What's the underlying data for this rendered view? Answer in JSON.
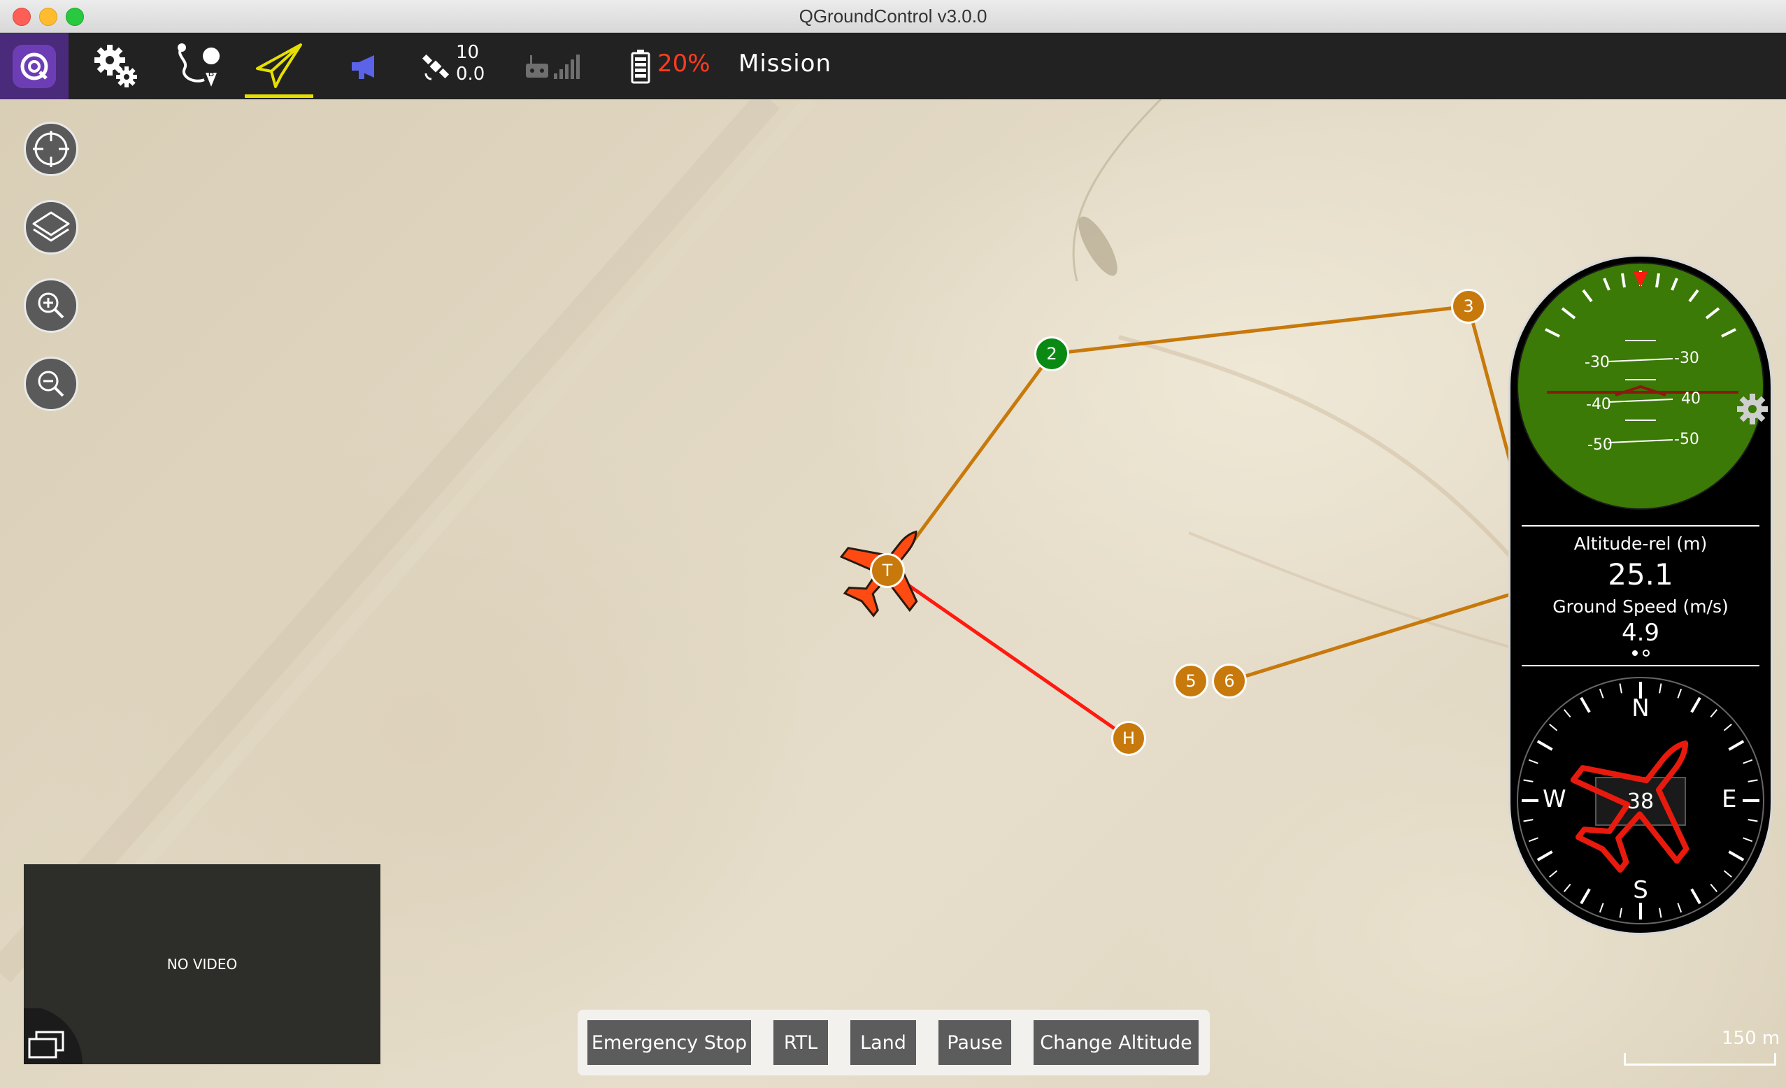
{
  "window": {
    "title": "QGroundControl v3.0.0"
  },
  "toolbar": {
    "satellite_count": "10",
    "hdop": "0.0",
    "battery_percent": "20%",
    "flight_mode": "Mission"
  },
  "map": {
    "waypoints": [
      "2",
      "3",
      "5",
      "6",
      "T",
      "H"
    ],
    "scale_label": "150 m"
  },
  "video": {
    "status": "NO VIDEO"
  },
  "actions": {
    "emergency_stop": "Emergency Stop",
    "rtl": "RTL",
    "land": "Land",
    "pause": "Pause",
    "change_altitude": "Change Altitude"
  },
  "instrument": {
    "pitch_labels": [
      "-30",
      "-40",
      "-50"
    ],
    "pitch_labels_right": [
      "-30",
      "40",
      "-50"
    ],
    "altitude_label": "Altitude-rel (m)",
    "altitude_value": "25.1",
    "ground_speed_label": "Ground Speed (m/s)",
    "ground_speed_value": "4.9",
    "heading_value": "38",
    "compass": {
      "n": "N",
      "e": "E",
      "s": "S",
      "w": "W"
    }
  },
  "colors": {
    "accent_yellow": "#e6e000",
    "vehicle": "#ff4a12",
    "waypoint": "#c7790b",
    "current_waypoint": "#0a8a12",
    "battery_low": "#ff3b1f"
  }
}
